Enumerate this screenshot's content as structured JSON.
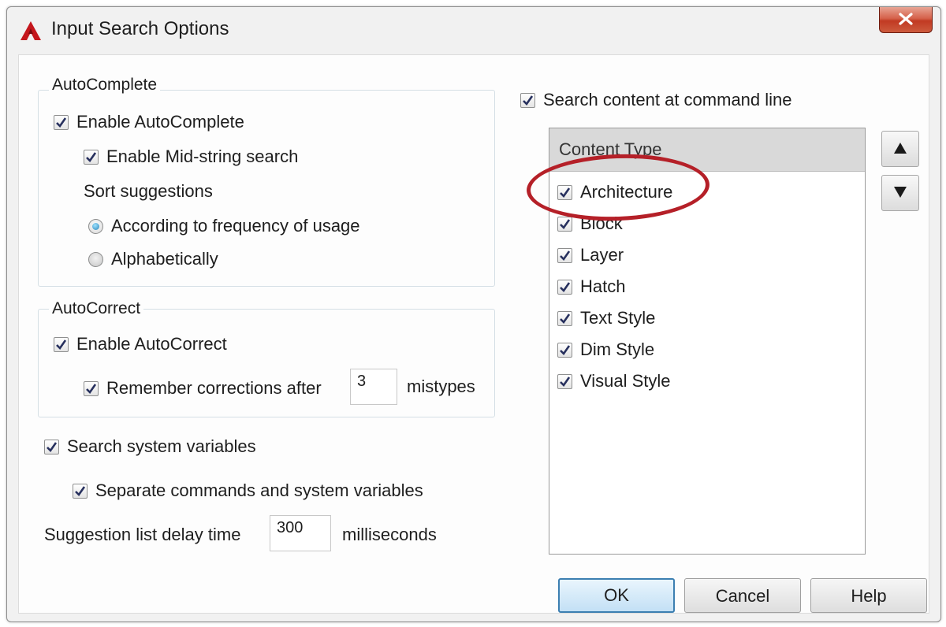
{
  "window": {
    "title": "Input Search Options",
    "icon": "autocad-a-icon",
    "close": "close-icon"
  },
  "autocomplete": {
    "legend": "AutoComplete",
    "enable": {
      "label": "Enable AutoComplete",
      "checked": true
    },
    "midstring": {
      "label": "Enable Mid-string search",
      "checked": true
    },
    "sort_label": "Sort suggestions",
    "sort_options": [
      {
        "label": "According to frequency of usage",
        "selected": true
      },
      {
        "label": "Alphabetically",
        "selected": false
      }
    ]
  },
  "autocorrect": {
    "legend": "AutoCorrect",
    "enable": {
      "label": "Enable AutoCorrect",
      "checked": true
    },
    "remember": {
      "label": "Remember corrections after",
      "checked": true,
      "value": "3",
      "suffix": "mistypes"
    }
  },
  "sysvars": {
    "search": {
      "label": "Search system variables",
      "checked": true
    },
    "separate": {
      "label": "Separate commands and system variables",
      "checked": true
    }
  },
  "delay": {
    "label": "Suggestion list delay time",
    "value": "300",
    "suffix": "milliseconds"
  },
  "content_search": {
    "label": "Search content at command line",
    "checked": true
  },
  "content_list": {
    "header": "Content Type",
    "items": [
      {
        "label": "Architecture",
        "checked": true
      },
      {
        "label": "Block",
        "checked": true
      },
      {
        "label": "Layer",
        "checked": true
      },
      {
        "label": "Hatch",
        "checked": true
      },
      {
        "label": "Text Style",
        "checked": true
      },
      {
        "label": "Dim Style",
        "checked": true
      },
      {
        "label": "Visual Style",
        "checked": true
      }
    ]
  },
  "buttons": {
    "ok": "OK",
    "cancel": "Cancel",
    "help": "Help"
  },
  "colors": {
    "accent": "#3c7fb1",
    "highlight": "#b52028",
    "checkmark": "#27305e"
  }
}
